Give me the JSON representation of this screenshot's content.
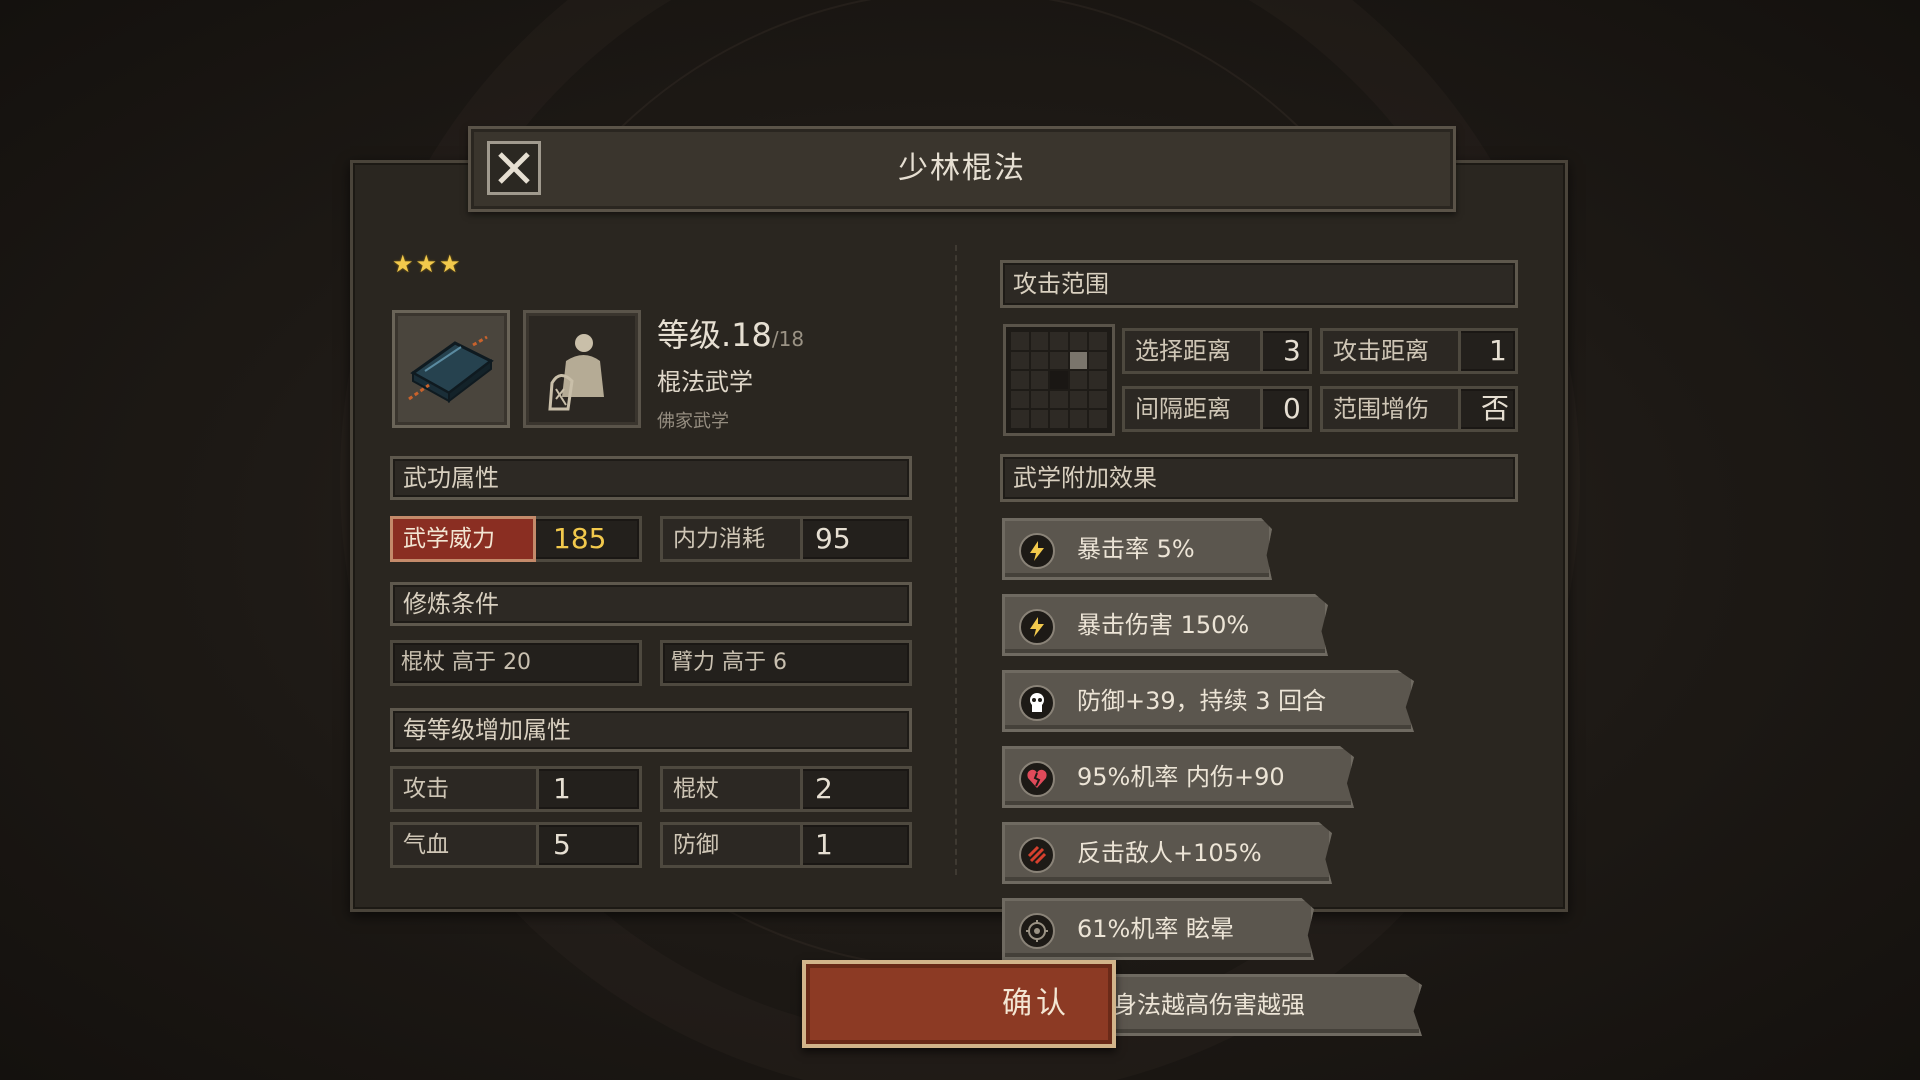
{
  "title": "少林棍法",
  "stars": 3,
  "skill": {
    "level_label": "等级",
    "level_value": ".18",
    "level_max": "/18",
    "type": "棍法武学",
    "school": "佛家武学"
  },
  "attributes": {
    "header": "武功属性",
    "power_label": "武学威力",
    "power_value": "185",
    "mp_label": "内力消耗",
    "mp_value": "95"
  },
  "requirements": {
    "header": "修炼条件",
    "items": [
      "棍杖 高于 20",
      "臂力 高于 6"
    ]
  },
  "per_level": {
    "header": "每等级增加属性",
    "items": [
      {
        "label": "攻击",
        "value": "1"
      },
      {
        "label": "棍杖",
        "value": "2"
      },
      {
        "label": "气血",
        "value": "5"
      },
      {
        "label": "防御",
        "value": "1"
      }
    ]
  },
  "range": {
    "header": "攻击范围",
    "items": [
      {
        "label": "选择距离",
        "value": "3"
      },
      {
        "label": "攻击距离",
        "value": "1"
      },
      {
        "label": "间隔距离",
        "value": "0"
      },
      {
        "label": "范围增伤",
        "value": "否"
      }
    ]
  },
  "effects": {
    "header": "武学附加效果",
    "items": [
      {
        "text": "暴击率 5%",
        "icon": "crit-rate-icon",
        "color": "#f2c94c"
      },
      {
        "text": "暴击伤害 150%",
        "icon": "crit-damage-icon",
        "color": "#f2c94c"
      },
      {
        "text": "防御+39，持续 3 回合",
        "icon": "defense-icon",
        "color": "#ffffff"
      },
      {
        "text": "95%机率 内伤+90",
        "icon": "broken-heart-icon",
        "color": "#e04a5a"
      },
      {
        "text": "反击敌人+105%",
        "icon": "counter-icon",
        "color": "#d6402e"
      },
      {
        "text": "61%机率 眩晕",
        "icon": "stun-icon",
        "color": "#9b9385"
      },
      {
        "text": "身法越高伤害越强",
        "icon": "",
        "color": ""
      }
    ]
  },
  "confirm_label": "确认"
}
